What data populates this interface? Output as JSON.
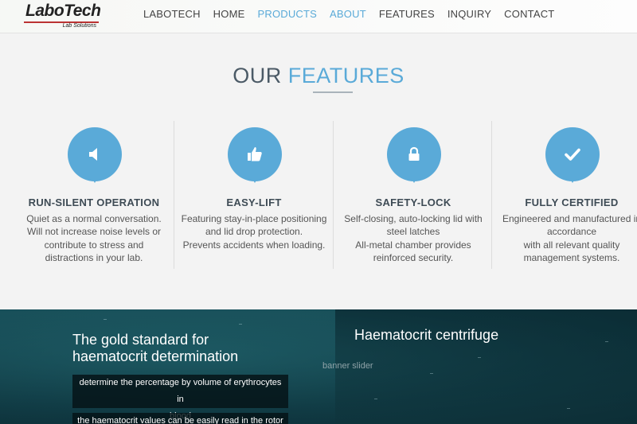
{
  "brand": {
    "name": "LaboTech",
    "tagline": "Lab Solutions",
    "rule_color": "#b33333"
  },
  "nav": {
    "items": [
      {
        "label": "LABOTECH",
        "active": false
      },
      {
        "label": "HOME",
        "active": false
      },
      {
        "label": "PRODUCTS",
        "active": true
      },
      {
        "label": "ABOUT",
        "active": true
      },
      {
        "label": "FEATURES",
        "active": false
      },
      {
        "label": "INQUIRY",
        "active": false
      },
      {
        "label": "CONTACT",
        "active": false
      }
    ],
    "active_color": "#5aaad8"
  },
  "features_section": {
    "title_prefix": "OUR",
    "title_accent": "FEATURES",
    "accent_color": "#5aaad8",
    "items": [
      {
        "icon": "speaker-icon",
        "title": "RUN-SILENT OPERATION",
        "lines": [
          "Quiet as a normal conversation.",
          "Will not increase noise levels or",
          "contribute to stress and",
          "distractions in your lab."
        ]
      },
      {
        "icon": "thumbs-up-icon",
        "title": "EASY-LIFT",
        "lines": [
          "Featuring stay-in-place positioning",
          "and lid drop protection.",
          "Prevents accidents when loading."
        ]
      },
      {
        "icon": "lock-icon",
        "title": "SAFETY-LOCK",
        "lines": [
          "Self-closing, auto-locking lid with",
          "steel latches",
          "All-metal chamber provides",
          "reinforced security."
        ]
      },
      {
        "icon": "check-icon",
        "title": "FULLY CERTIFIED",
        "lines": [
          "Engineered and manufactured in",
          "accordance",
          "with all relevant quality",
          "management systems."
        ]
      }
    ]
  },
  "banner": {
    "heading_line1": "The gold standard for",
    "heading_line2": "haematocrit determination",
    "box1_line1": "determine the percentage by volume of erythrocytes in",
    "box1_line2": "blood",
    "box2_line1": "the haematocrit values can be easily read in the rotor",
    "right_title": "Haematocrit centrifuge",
    "slider_alt": "banner slider"
  }
}
